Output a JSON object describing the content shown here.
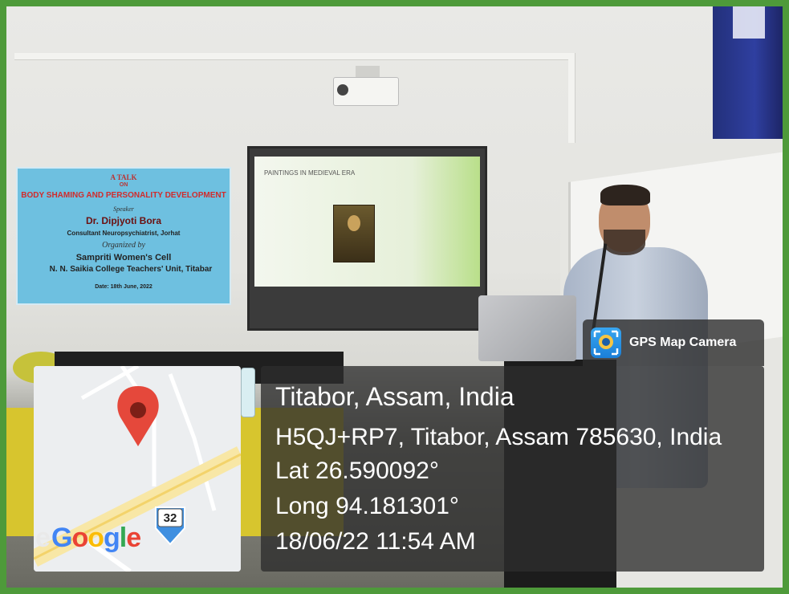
{
  "banner": {
    "line1": "A TALK",
    "line2": "ON",
    "line3": "BODY SHAMING AND PERSONALITY DEVELOPMENT",
    "line4": "Speaker",
    "line5": "Dr. Dipjyoti Bora",
    "line6": "Consultant Neuropsychiatrist, Jorhat",
    "line7": "Organized by",
    "line8": "Sampriti Women's Cell",
    "line9": "N. N. Saikia College Teachers' Unit, Titabar",
    "line10": "Date: 18th June, 2022"
  },
  "slide": {
    "title": "PAINTINGS IN MEDIEVAL ERA"
  },
  "badge": {
    "label": "GPS Map Camera",
    "icon": "gps-camera-icon"
  },
  "map": {
    "route_number": "32",
    "google_label": "Google",
    "partial_text": "e",
    "pin_icon": "map-pin-icon"
  },
  "location": {
    "title": "Titabor, Assam, India",
    "address": "H5QJ+RP7, Titabor, Assam 785630, India",
    "lat": "Lat 26.590092°",
    "long": "Long 94.181301°",
    "datetime": "18/06/22 11:54 AM"
  },
  "colors": {
    "frame_green": "#4e9a3a",
    "pin_red": "#e5483b",
    "panel_bg": "#2d2d2d",
    "route_blue": "#3f8fe0"
  }
}
